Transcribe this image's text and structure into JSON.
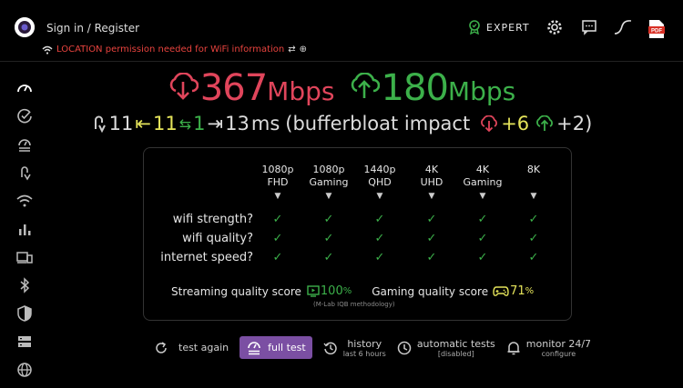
{
  "header": {
    "signin": "Sign in / Register",
    "warning": "LOCATION permission needed for WiFi information",
    "expert_label": "EXPERT",
    "pdf_label": "PDF"
  },
  "speeds": {
    "download_value": "367",
    "download_unit": "Mbps",
    "upload_value": "180",
    "upload_unit": "Mbps",
    "download_color": "#e0455b",
    "upload_color": "#3cb04a"
  },
  "latency": {
    "ping": "11",
    "idle": "11",
    "jitter": "1",
    "loaded": "13",
    "unit": "ms",
    "bufferbloat_text": "(bufferbloat impact",
    "down_impact": "+6",
    "up_impact": "+2)"
  },
  "quality": {
    "columns": [
      {
        "line1": "1080p",
        "line2": "FHD"
      },
      {
        "line1": "1080p",
        "line2": "Gaming"
      },
      {
        "line1": "1440p",
        "line2": "QHD"
      },
      {
        "line1": "4K",
        "line2": "UHD"
      },
      {
        "line1": "4K",
        "line2": "Gaming"
      },
      {
        "line1": "8K",
        "line2": ""
      }
    ],
    "arrow": "▼",
    "rows": [
      "wifi strength?",
      "wifi quality?",
      "internet speed?"
    ],
    "check": "✓",
    "streaming_label": "Streaming quality score",
    "streaming_value": "100",
    "gaming_label": "Gaming quality score",
    "gaming_value": "71",
    "percent": "%",
    "methodology": "(M-Lab IQB methodology)"
  },
  "bottom": {
    "test_again": "test again",
    "full_test": "full test",
    "history": "history",
    "history_sub": "last 6 hours",
    "automatic": "automatic tests",
    "automatic_sub": "[disabled]",
    "monitor": "monitor 24/7",
    "monitor_sub": "configure"
  }
}
